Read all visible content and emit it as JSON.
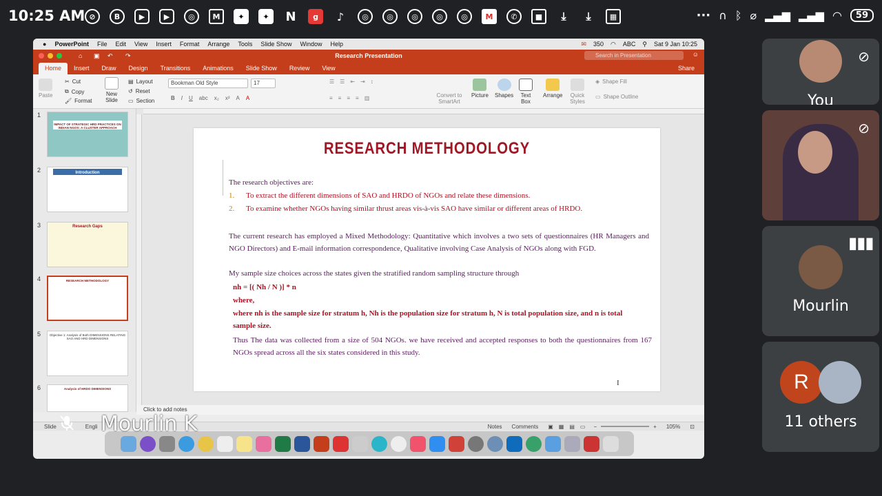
{
  "status_bar": {
    "time": "10:25 AM",
    "battery": "59",
    "left_icons": [
      "no-sign-icon",
      "b-icon",
      "youtube-icon",
      "youtube-icon",
      "chrome-icon",
      "gmail-icon",
      "photos-icon",
      "photos-icon",
      "n-icon",
      "g-icon",
      "tiktok-icon",
      "chrome-icon",
      "chrome-icon",
      "chrome-icon",
      "chrome-icon",
      "chrome-icon",
      "gmail-icon",
      "whatsapp-icon",
      "video-icon",
      "download-icon",
      "download-icon",
      "calendar-icon"
    ],
    "more": "···"
  },
  "mac_menu": {
    "app": "PowerPoint",
    "items": [
      "File",
      "Edit",
      "View",
      "Insert",
      "Format",
      "Arrange",
      "Tools",
      "Slide Show",
      "Window",
      "Help"
    ],
    "mail_count": "350",
    "right_text": [
      "ABC",
      "Sat 9 Jan  10:25"
    ]
  },
  "window": {
    "title": "Research Presentation",
    "search_placeholder": "Search in Presentation",
    "share": "Share"
  },
  "tabs": [
    "Home",
    "Insert",
    "Draw",
    "Design",
    "Transitions",
    "Animations",
    "Slide Show",
    "Review",
    "View"
  ],
  "active_tab": "Home",
  "ribbon": {
    "paste": "Paste",
    "cut": "Cut",
    "copy": "Copy",
    "format": "Format",
    "new_slide": "New Slide",
    "layout": "Layout",
    "reset": "Reset",
    "section": "Section",
    "font": "Bookman Old Style",
    "font_size": "17",
    "convert": "Convert to SmartArt",
    "picture": "Picture",
    "shapes": "Shapes",
    "text_box": "Text Box",
    "arrange": "Arrange",
    "quick_styles": "Quick Styles",
    "shape_fill": "Shape Fill",
    "shape_outline": "Shape Outline"
  },
  "thumbnails": [
    {
      "num": "1",
      "title": "IMPACT OF STRATEGIC HRD PRACTICES ON INDIAN NGOS: A CLUSTER APPROACH"
    },
    {
      "num": "2",
      "title": "Introduction"
    },
    {
      "num": "3",
      "title": "Research Gaps"
    },
    {
      "num": "4",
      "title": "RESEARCH METHODOLOGY"
    },
    {
      "num": "5",
      "title": "Objective 1: Analysis of Both DIMENSIONS RELATING SAO AND HRD DIMENSIONS"
    },
    {
      "num": "6",
      "title": "Analysis of HRDO DIMENSIONS"
    }
  ],
  "slide": {
    "title": "RESEARCH METHODOLOGY",
    "intro": "The research objectives are:",
    "objectives": [
      {
        "n": "1.",
        "text": "To extract the different dimensions of SAO and HRDO of NGOs and relate these dimensions."
      },
      {
        "n": "2.",
        "text": "To examine whether NGOs having similar thrust areas vis-à-vis SAO have similar or different areas of HRDO."
      }
    ],
    "para1": "The current research has employed a Mixed Methodology: Quantitative which involves a two sets of questionnaires (HR Managers and NGO Directors) and E-mail information correspondence, Qualitative involving Case Analysis of NGOs along with FGD.",
    "para2": "My  sample size choices across the states given the stratified random sampling structure through",
    "formula": "nh = [( Nh / N )] * n",
    "where": "where,",
    "definition": "where nh is the  sample size for stratum h, Nh is the population size for stratum h, N is total population size, and n is total sample size.",
    "para3": "Thus The data was collected from a size of 504 NGOs. we have received and accepted responses to both the questionnaires from 167 NGOs spread across all the six states considered in this study."
  },
  "notes_placeholder": "Click to add notes",
  "statusbar": {
    "slide": "Slide",
    "language": "Engli",
    "notes": "Notes",
    "comments": "Comments",
    "zoom": "105%"
  },
  "presenter_name": "Mourlin K",
  "participants": [
    {
      "name": "You"
    },
    {
      "name": ""
    },
    {
      "name": "Mourlin"
    },
    {
      "name": "11 others",
      "initial": "R"
    }
  ]
}
